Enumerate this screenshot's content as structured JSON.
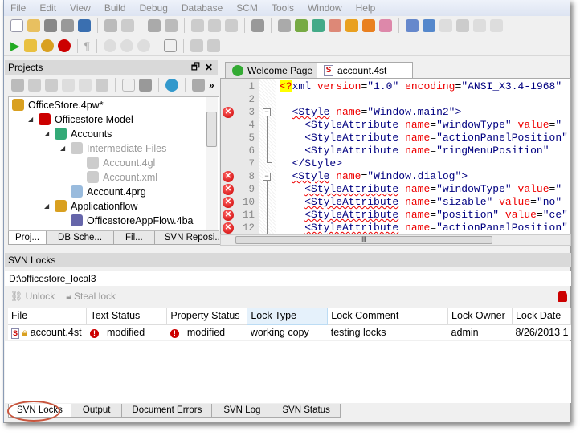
{
  "menu": [
    "File",
    "Edit",
    "View",
    "Build",
    "Debug",
    "Database",
    "SCM",
    "Tools",
    "Window",
    "Help"
  ],
  "projects": {
    "title": "Projects",
    "tree": [
      {
        "label": "OfficeStore.4pw*",
        "level": 0,
        "muted": false
      },
      {
        "label": "Officestore Model",
        "level": 1,
        "muted": false
      },
      {
        "label": "Accounts",
        "level": 2,
        "muted": false
      },
      {
        "label": "Intermediate Files",
        "level": 3,
        "muted": true
      },
      {
        "label": "Account.4gl",
        "level": 4,
        "muted": true
      },
      {
        "label": "Account.xml",
        "level": 4,
        "muted": true
      },
      {
        "label": "Account.4prg",
        "level": 3,
        "muted": false
      },
      {
        "label": "Applicationflow",
        "level": 2,
        "muted": false
      },
      {
        "label": "OfficestoreAppFlow.4ba",
        "level": 3,
        "muted": false
      }
    ],
    "tabs": [
      "Proj...",
      "DB Sche...",
      "Fil...",
      "SVN Reposi..."
    ]
  },
  "editor": {
    "tabs": [
      "Welcome Page",
      "account.4st"
    ],
    "error_lines": [
      3,
      8,
      9,
      10,
      11,
      12
    ]
  },
  "svn": {
    "title": "SVN Locks",
    "path": "D:\\officestore_local3",
    "unlock": "Unlock",
    "steal": "Steal lock",
    "columns": [
      "File",
      "Text Status",
      "Property Status",
      "Lock Type",
      "Lock Comment",
      "Lock Owner",
      "Lock Date"
    ],
    "sorted_column": "Lock Type",
    "rows": [
      {
        "file": "account.4st",
        "text_status": "modified",
        "property_status": "modified",
        "lock_type": "working copy",
        "lock_comment": "testing locks",
        "owner": "admin",
        "date": "8/26/2013 1"
      }
    ]
  },
  "bottom_tabs": [
    "SVN Locks",
    "Output",
    "Document Errors",
    "SVN Log",
    "SVN Status"
  ],
  "colors": {
    "error": "#cc0000",
    "highlight_circle": "#c8553d"
  }
}
